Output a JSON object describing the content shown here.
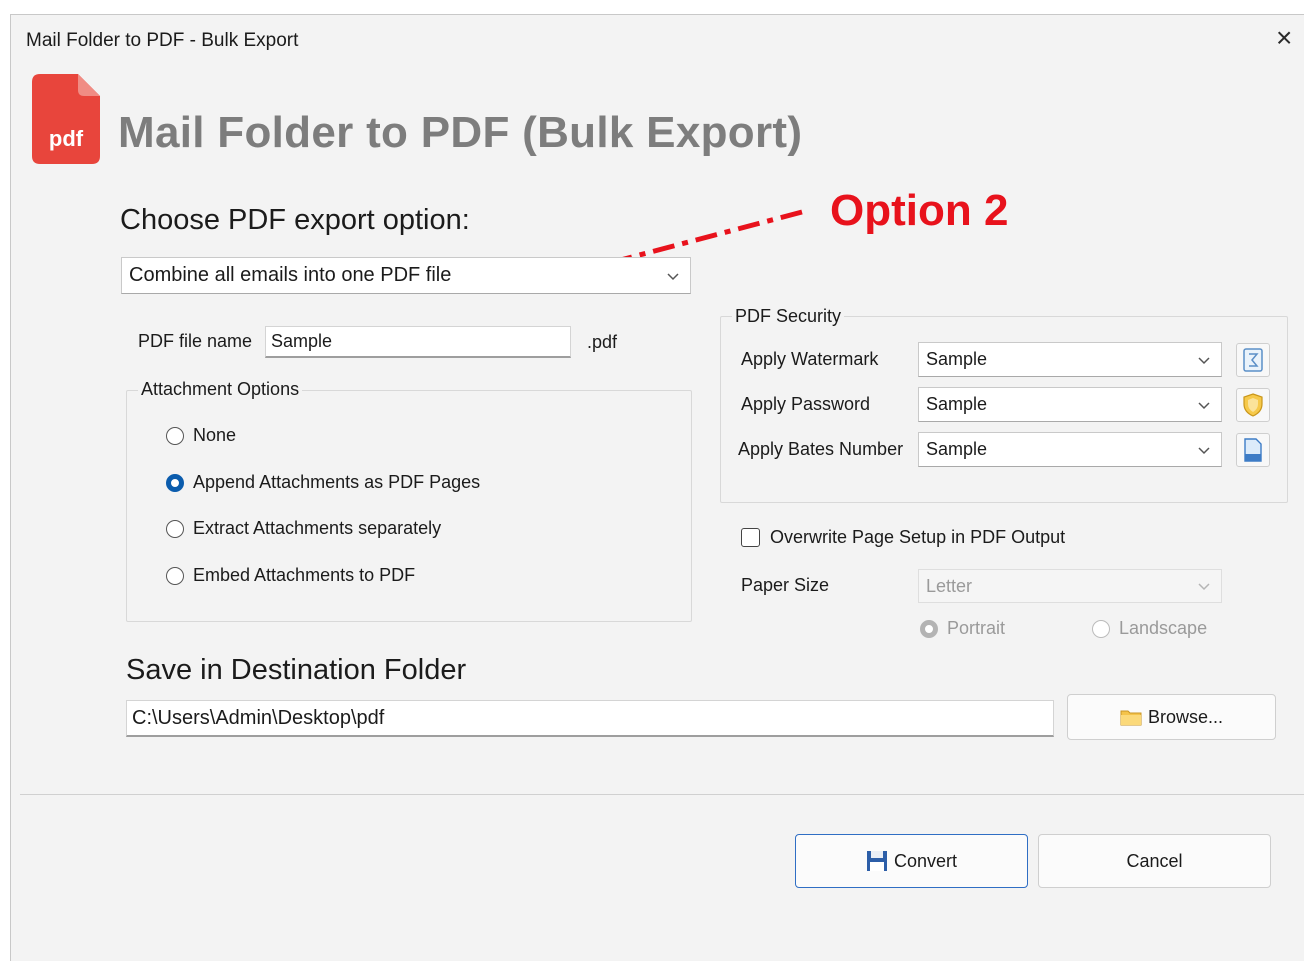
{
  "window": {
    "title": "Mail Folder to PDF - Bulk Export",
    "close_glyph": "×"
  },
  "header": {
    "logo_text": "pdf",
    "title": "Mail Folder to PDF (Bulk Export)"
  },
  "export_option": {
    "heading": "Choose PDF export option:",
    "selected": "Combine all emails into one PDF file"
  },
  "annotation": {
    "text": "Option 2",
    "color": "#e8121c"
  },
  "file_name": {
    "label": "PDF file name",
    "value": "Sample",
    "extension": ".pdf"
  },
  "attachments": {
    "legend": "Attachment Options",
    "options": [
      {
        "label": "None",
        "checked": false
      },
      {
        "label": "Append Attachments as PDF Pages",
        "checked": true
      },
      {
        "label": "Extract Attachments separately",
        "checked": false
      },
      {
        "label": "Embed Attachments to PDF",
        "checked": false
      }
    ]
  },
  "security": {
    "legend": "PDF Security",
    "rows": [
      {
        "label": "Apply Watermark",
        "value": "Sample",
        "icon": "watermark-icon"
      },
      {
        "label": "Apply Password",
        "value": "Sample",
        "icon": "shield-icon"
      },
      {
        "label": "Apply Bates Number",
        "value": "Sample",
        "icon": "document-icon"
      }
    ]
  },
  "page_setup": {
    "overwrite_label": "Overwrite Page Setup in PDF Output",
    "overwrite_checked": false,
    "paper_size_label": "Paper Size",
    "paper_size_value": "Letter",
    "portrait_label": "Portrait",
    "landscape_label": "Landscape",
    "orientation": "Portrait"
  },
  "destination": {
    "heading": "Save in Destination Folder",
    "path": "C:\\Users\\Admin\\Desktop\\pdf",
    "browse_label": "Browse..."
  },
  "footer": {
    "convert_label": "Convert",
    "cancel_label": "Cancel"
  },
  "colors": {
    "accent": "#0b5cad",
    "logo_red": "#e8453c",
    "title_gray": "#7d7d7d"
  }
}
